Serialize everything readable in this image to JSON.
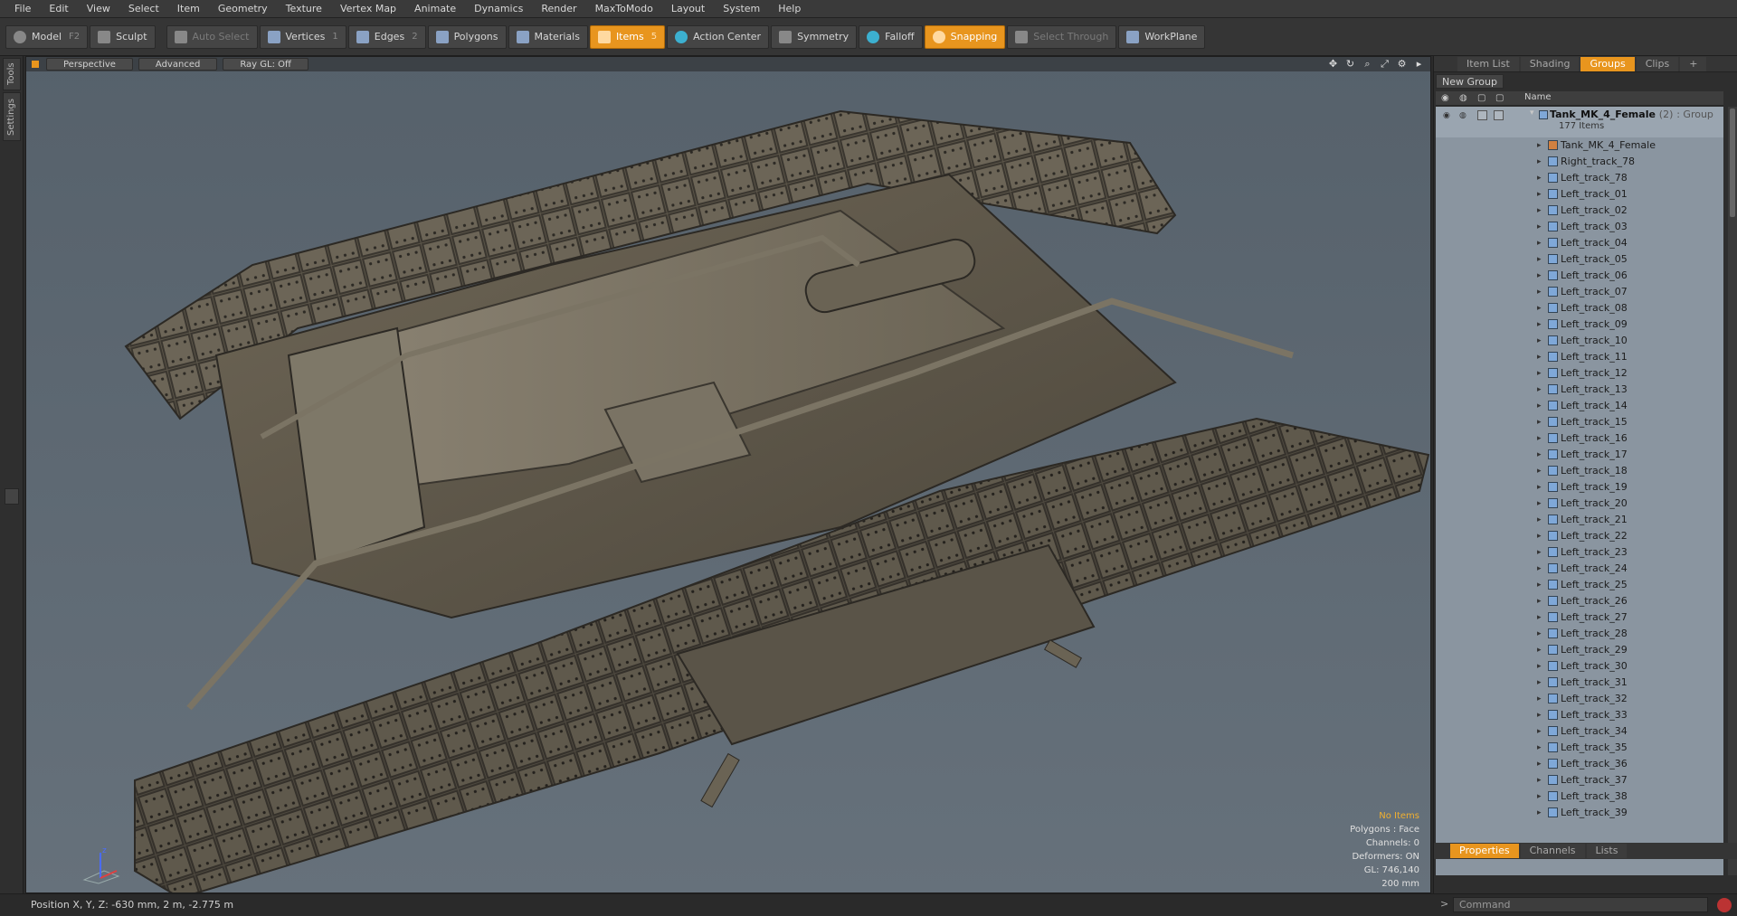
{
  "menu": [
    "File",
    "Edit",
    "View",
    "Select",
    "Item",
    "Geometry",
    "Texture",
    "Vertex Map",
    "Animate",
    "Dynamics",
    "Render",
    "MaxToModo",
    "Layout",
    "System",
    "Help"
  ],
  "toolbar": {
    "model": "Model",
    "model_key": "F2",
    "sculpt": "Sculpt",
    "auto_select": "Auto Select",
    "vertices": "Vertices",
    "vertices_key": "1",
    "edges": "Edges",
    "edges_key": "2",
    "polygons": "Polygons",
    "materials": "Materials",
    "items": "Items",
    "action_center": "Action Center",
    "symmetry": "Symmetry",
    "falloff": "Falloff",
    "snapping": "Snapping",
    "select_through": "Select Through",
    "workplane": "WorkPlane"
  },
  "side_tabs": [
    "Tools",
    "Settings"
  ],
  "viewport": {
    "view": "Perspective",
    "shading": "Advanced",
    "raygl": "Ray GL: Off",
    "info": {
      "selection": "No Items",
      "polygons": "Polygons : Face",
      "channels": "Channels: 0",
      "deformers": "Deformers: ON",
      "gl": "GL: 746,140",
      "scale": "200 mm"
    }
  },
  "panel": {
    "tabs": [
      "Item List",
      "Shading",
      "Groups",
      "Clips"
    ],
    "active_tab": "Groups",
    "new_group": "New Group",
    "column_name": "Name",
    "group": {
      "name": "Tank_MK_4_Female",
      "count": "(2)",
      "type": ": Group",
      "items": "177 Items"
    },
    "items": [
      "Tank_MK_4_Female",
      "Right_track_78",
      "Left_track_78",
      "Left_track_01",
      "Left_track_02",
      "Left_track_03",
      "Left_track_04",
      "Left_track_05",
      "Left_track_06",
      "Left_track_07",
      "Left_track_08",
      "Left_track_09",
      "Left_track_10",
      "Left_track_11",
      "Left_track_12",
      "Left_track_13",
      "Left_track_14",
      "Left_track_15",
      "Left_track_16",
      "Left_track_17",
      "Left_track_18",
      "Left_track_19",
      "Left_track_20",
      "Left_track_21",
      "Left_track_22",
      "Left_track_23",
      "Left_track_24",
      "Left_track_25",
      "Left_track_26",
      "Left_track_27",
      "Left_track_28",
      "Left_track_29",
      "Left_track_30",
      "Left_track_31",
      "Left_track_32",
      "Left_track_33",
      "Left_track_34",
      "Left_track_35",
      "Left_track_36",
      "Left_track_37",
      "Left_track_38",
      "Left_track_39"
    ],
    "bottom_tabs": [
      "Properties",
      "Channels",
      "Lists"
    ],
    "bottom_active": "Properties"
  },
  "status": {
    "position": "Position X, Y, Z:   -630 mm, 2 m, -2.775 m"
  },
  "command": {
    "prompt": ">",
    "placeholder": "Command"
  },
  "colors": {
    "accent": "#e8951e",
    "viewport_bg": "#5b6670",
    "list_bg": "#8a95a0"
  }
}
